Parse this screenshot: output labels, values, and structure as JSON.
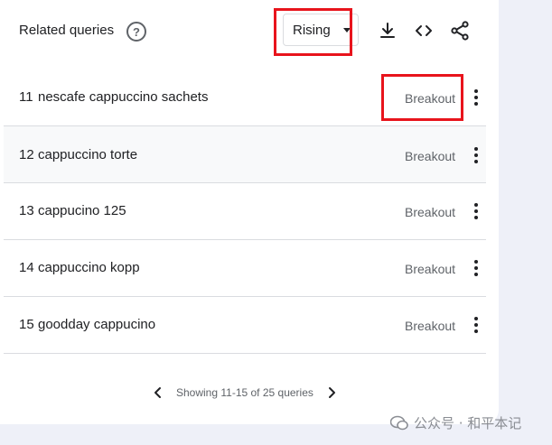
{
  "header": {
    "title": "Related queries",
    "help_icon": "?",
    "filter": {
      "selected": "Rising"
    },
    "tools": [
      "download-icon",
      "embed-code-icon",
      "share-icon"
    ]
  },
  "rows": [
    {
      "rank": "11",
      "query": "nescafe cappuccino sachets",
      "value": "Breakout"
    },
    {
      "rank": "12",
      "query": "cappuccino torte",
      "value": "Breakout"
    },
    {
      "rank": "13",
      "query": "cappucino 125",
      "value": "Breakout"
    },
    {
      "rank": "14",
      "query": "cappuccino kopp",
      "value": "Breakout"
    },
    {
      "rank": "15",
      "query": "goodday cappucino",
      "value": "Breakout"
    }
  ],
  "pager": {
    "text": "Showing 11-15 of 25 queries"
  },
  "watermark": {
    "text": "公众号 · 和平本记"
  },
  "colors": {
    "highlight": "#e8141c",
    "text_secondary": "#5f6368"
  }
}
